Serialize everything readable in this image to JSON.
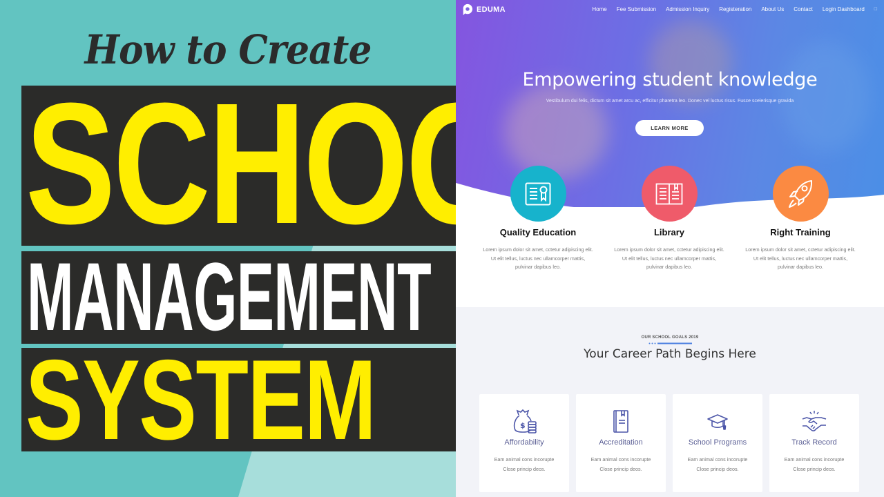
{
  "thumbnail": {
    "script_title": "How to Create",
    "word_1": "SCHOOL",
    "word_2": "MANAGEMENT",
    "word_3": "SYSTEM",
    "colors": {
      "background": "#62c4c1",
      "band": "#2b2b29",
      "yellow": "#ffee00",
      "white": "#ffffff"
    }
  },
  "site": {
    "logo_text": "EDUMA",
    "nav": [
      "Home",
      "Fee Submission",
      "Admission Inquiry",
      "Registeration",
      "About Us",
      "Contact",
      "Login Dashboard"
    ],
    "nav_search_icon": "search-icon",
    "hero": {
      "title": "Empowering student knowledge",
      "subtitle": "Vestibulum dui felis, dictum sit amet arcu ac, efficitur pharetra leo. Donec vel luctus risus. Fusce scelerisque gravida",
      "button": "LEARN MORE"
    },
    "features": [
      {
        "title": "Quality Education",
        "icon": "certificate-icon",
        "color": "#17b3cc",
        "text": "Lorem ipsum dolor sit amet, cctetur adipiscing elit. Ut elit tellus, luctus nec ullamcorper mattis, pulvinar dapibus leo."
      },
      {
        "title": "Library",
        "icon": "open-book-icon",
        "color": "#ef5b6a",
        "text": "Lorem ipsum dolor sit amet, cctetur adipiscing elit. Ut elit tellus, luctus nec ullamcorper mattis, pulvinar dapibus leo."
      },
      {
        "title": "Right Training",
        "icon": "rocket-icon",
        "color": "#fb8a42",
        "text": "Lorem ipsum dolor sit amet, cctetur adipiscing elit. Ut elit tellus, luctus nec ullamcorper mattis, pulvinar dapibus leo."
      }
    ],
    "goals": {
      "kicker": "OUR SCHOOL GOALS 2019",
      "title": "Your Career Path Begins Here",
      "accent": "#4a7fe0"
    },
    "cards": [
      {
        "title": "Affordability",
        "icon": "money-bag-icon",
        "line1": "Eam animal cons incorupte",
        "line2": "Close princip deos."
      },
      {
        "title": "Accreditation",
        "icon": "book-icon",
        "line1": "Eam animal cons incorupte",
        "line2": "Close princip deos."
      },
      {
        "title": "School Programs",
        "icon": "graduation-cap-icon",
        "line1": "Eam animal cons incorupte",
        "line2": "Close princip deos."
      },
      {
        "title": "Track Record",
        "icon": "handshake-icon",
        "line1": "Eam animal cons incorupte",
        "line2": "Close princip deos."
      }
    ],
    "icon_color": "#4b55a8"
  }
}
